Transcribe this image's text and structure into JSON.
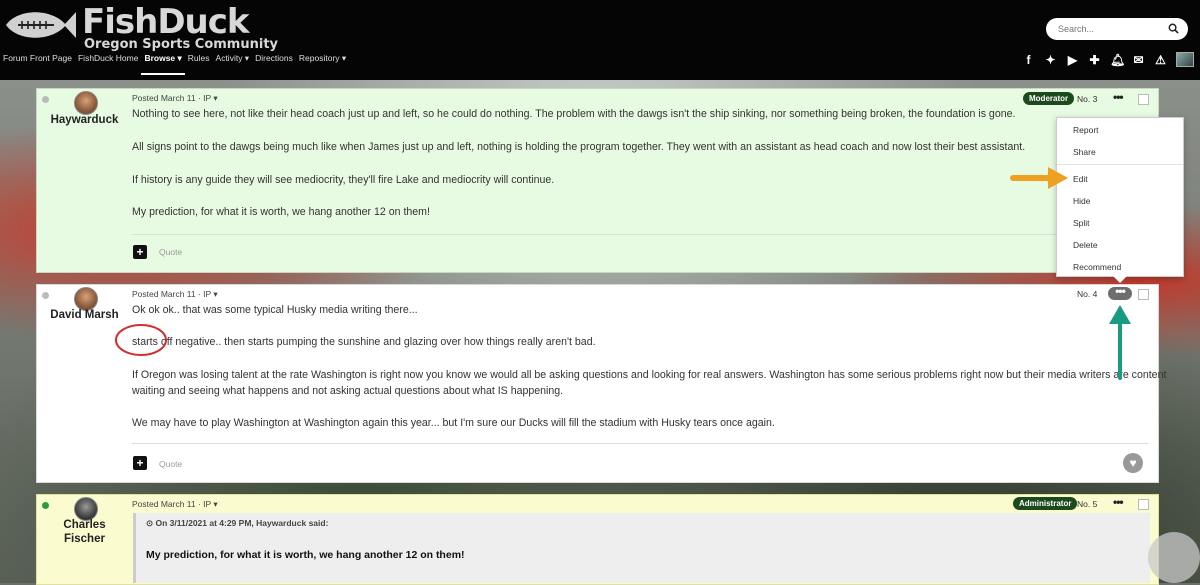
{
  "header": {
    "logo_title": "FishDuck",
    "logo_subtitle": "Oregon Sports Community",
    "nav": [
      "Forum Front Page",
      "FishDuck Home",
      "Browse ▾",
      "Rules",
      "Activity ▾",
      "Directions",
      "Repository ▾"
    ],
    "search_placeholder": "Search...",
    "social_icons": [
      "facebook-icon",
      "twitter-icon",
      "youtube-icon",
      "plus-icon",
      "bell-icon",
      "mail-icon",
      "warning-icon",
      "user-avatar"
    ]
  },
  "posts": [
    {
      "author": "Haywarduck",
      "meta": "Posted March 11 · IP ▾",
      "badge": "Moderator",
      "number": "No. 3",
      "paragraphs": [
        "Nothing to see here, not like their head coach just up and left, so he could do nothing. The problem with the dawgs isn't the ship sinking, nor something being broken, the foundation is gone.",
        "All signs point to the dawgs being much like when James just up and left, nothing is holding the program together. They went with an assistant as head coach and now lost their best assistant.",
        "If history is any guide they will see mediocrity, they'll fire Lake and mediocrity will continue.",
        "My prediction, for what it is worth, we hang another 12 on them!"
      ],
      "quote_label": "Quote"
    },
    {
      "author": "David Marsh",
      "meta": "Posted March 11 · IP ▾",
      "number": "No. 4",
      "paragraphs": [
        "Ok ok ok.. that was some typical Husky media writing there...",
        "starts off negative.. then starts pumping the sunshine and glazing over how things really aren't bad.",
        "If Oregon was losing talent at the rate Washington is right now you know we would all be asking questions and looking for real answers. Washington has some serious problems right now but their media writers are content",
        "waiting and seeing what happens and not asking actual questions about what IS happening.",
        "We may have to play Washington at Washington again this year... but I'm sure our Ducks will fill the stadium with Husky tears once again."
      ],
      "quote_label": "Quote"
    },
    {
      "author_line1": "Charles",
      "author_line2": "Fischer",
      "meta": "Posted March 11 · IP ▾",
      "badge": "Administrator",
      "number": "No. 5",
      "quote_header": "On 3/11/2021 at 4:29 PM, Haywarduck said:",
      "quote_text": "My prediction, for what it is worth, we hang another 12 on them!"
    }
  ],
  "menu": [
    "Report",
    "Share",
    "Edit",
    "Hide",
    "Split",
    "Delete",
    "Recommend"
  ],
  "annotations": {
    "arrow_orange": "#f0a020",
    "arrow_teal": "#1a9a80",
    "circle_red": "#d03030"
  }
}
